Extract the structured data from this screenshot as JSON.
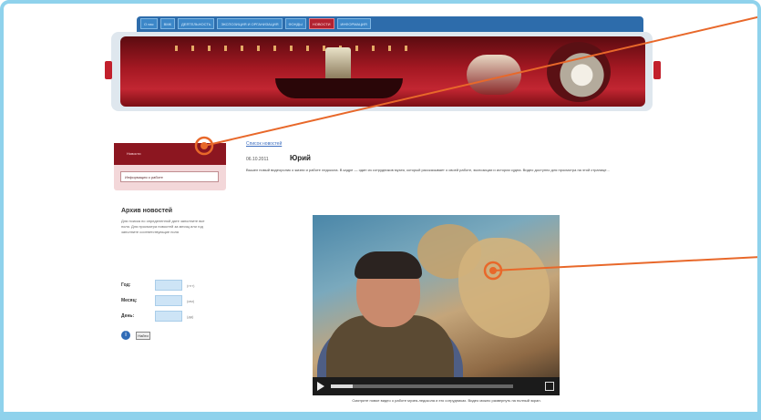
{
  "tabs": [
    {
      "label": "О нас",
      "active": false
    },
    {
      "label": "ВМК",
      "active": false
    },
    {
      "label": "ДЕЯТЕЛЬНОСТЬ",
      "active": false
    },
    {
      "label": "ЭКСПОЗИЦИЯ И ОРГАНИЗАЦИЯ",
      "active": false
    },
    {
      "label": "ФОНДЫ",
      "active": false
    },
    {
      "label": "НОВОСТИ",
      "active": true
    },
    {
      "label": "ИНФОРМАЦИЯ",
      "active": false
    }
  ],
  "sidebar": {
    "active_item": "Новости",
    "item": "Информация о работе",
    "archive_title": "Архив новостей",
    "archive_text": "Для поиска по определенной дате заполните все поля. Для просмотра новостей за месяц или год заполните соответствующие поля",
    "form": {
      "year_label": "Год:",
      "month_label": "Месяц:",
      "day_label": "День:",
      "year_hint": "(гггг)",
      "month_hint": "(мм)",
      "day_hint": "(дд)"
    },
    "find_label": "Найти"
  },
  "main": {
    "back_link": "Список новостей",
    "date": "06.10.2011",
    "title": "Юрий",
    "lead": "Вышел новый видеоролик о жизни и работе ледокола. В кадре — один из сотрудников музея, который рассказывает о своей работе, экспозиции и истории судна. Видео доступно для просмотра на этой странице...",
    "caption": "Смотрите новое видео о работе музея-ледокола и его сотрудниках. Видео можно развернуть на полный экран."
  },
  "colors": {
    "accent_red": "#b22230",
    "tab_blue": "#2d6cab",
    "callout_orange": "#e8682a",
    "frame_blue": "#8fd2ec"
  }
}
